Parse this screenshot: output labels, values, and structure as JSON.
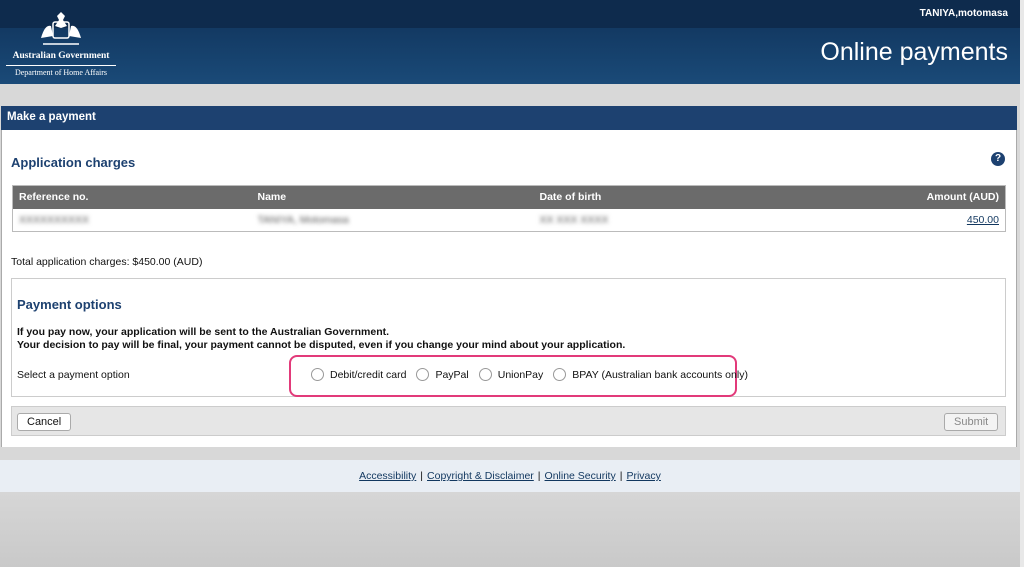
{
  "header": {
    "user": "TANIYA,motomasa",
    "title": "Online payments",
    "org": "Australian Government",
    "dept": "Department of Home Affairs"
  },
  "panel": {
    "title": "Make a payment"
  },
  "charges": {
    "title": "Application charges",
    "columns": {
      "reference": "Reference no.",
      "name": "Name",
      "dob": "Date of birth",
      "amount": "Amount (AUD)"
    },
    "row": {
      "reference": "XXXXXXXXXX",
      "name": "TANIYA, Motomasa",
      "dob": "XX XXX XXXX",
      "amount": "450.00"
    },
    "total": "Total application charges: $450.00 (AUD)"
  },
  "payment": {
    "title": "Payment options",
    "warning_line1": "If you pay now, your application will be sent to the Australian Government.",
    "warning_line2": "Your decision to pay will be final, your payment cannot be disputed, even if you change your mind about your application.",
    "select_label": "Select a payment option",
    "options": [
      "Debit/credit card",
      "PayPal",
      "UnionPay",
      "BPAY (Australian bank accounts only)"
    ]
  },
  "actions": {
    "cancel": "Cancel",
    "submit": "Submit"
  },
  "footer": {
    "links": [
      "Accessibility",
      "Copyright & Disclaimer",
      "Online Security",
      "Privacy"
    ],
    "separator": "|"
  },
  "colors": {
    "navy": "#1d4170",
    "highlight": "#e23a7a",
    "table_header": "#6b6b6b"
  }
}
